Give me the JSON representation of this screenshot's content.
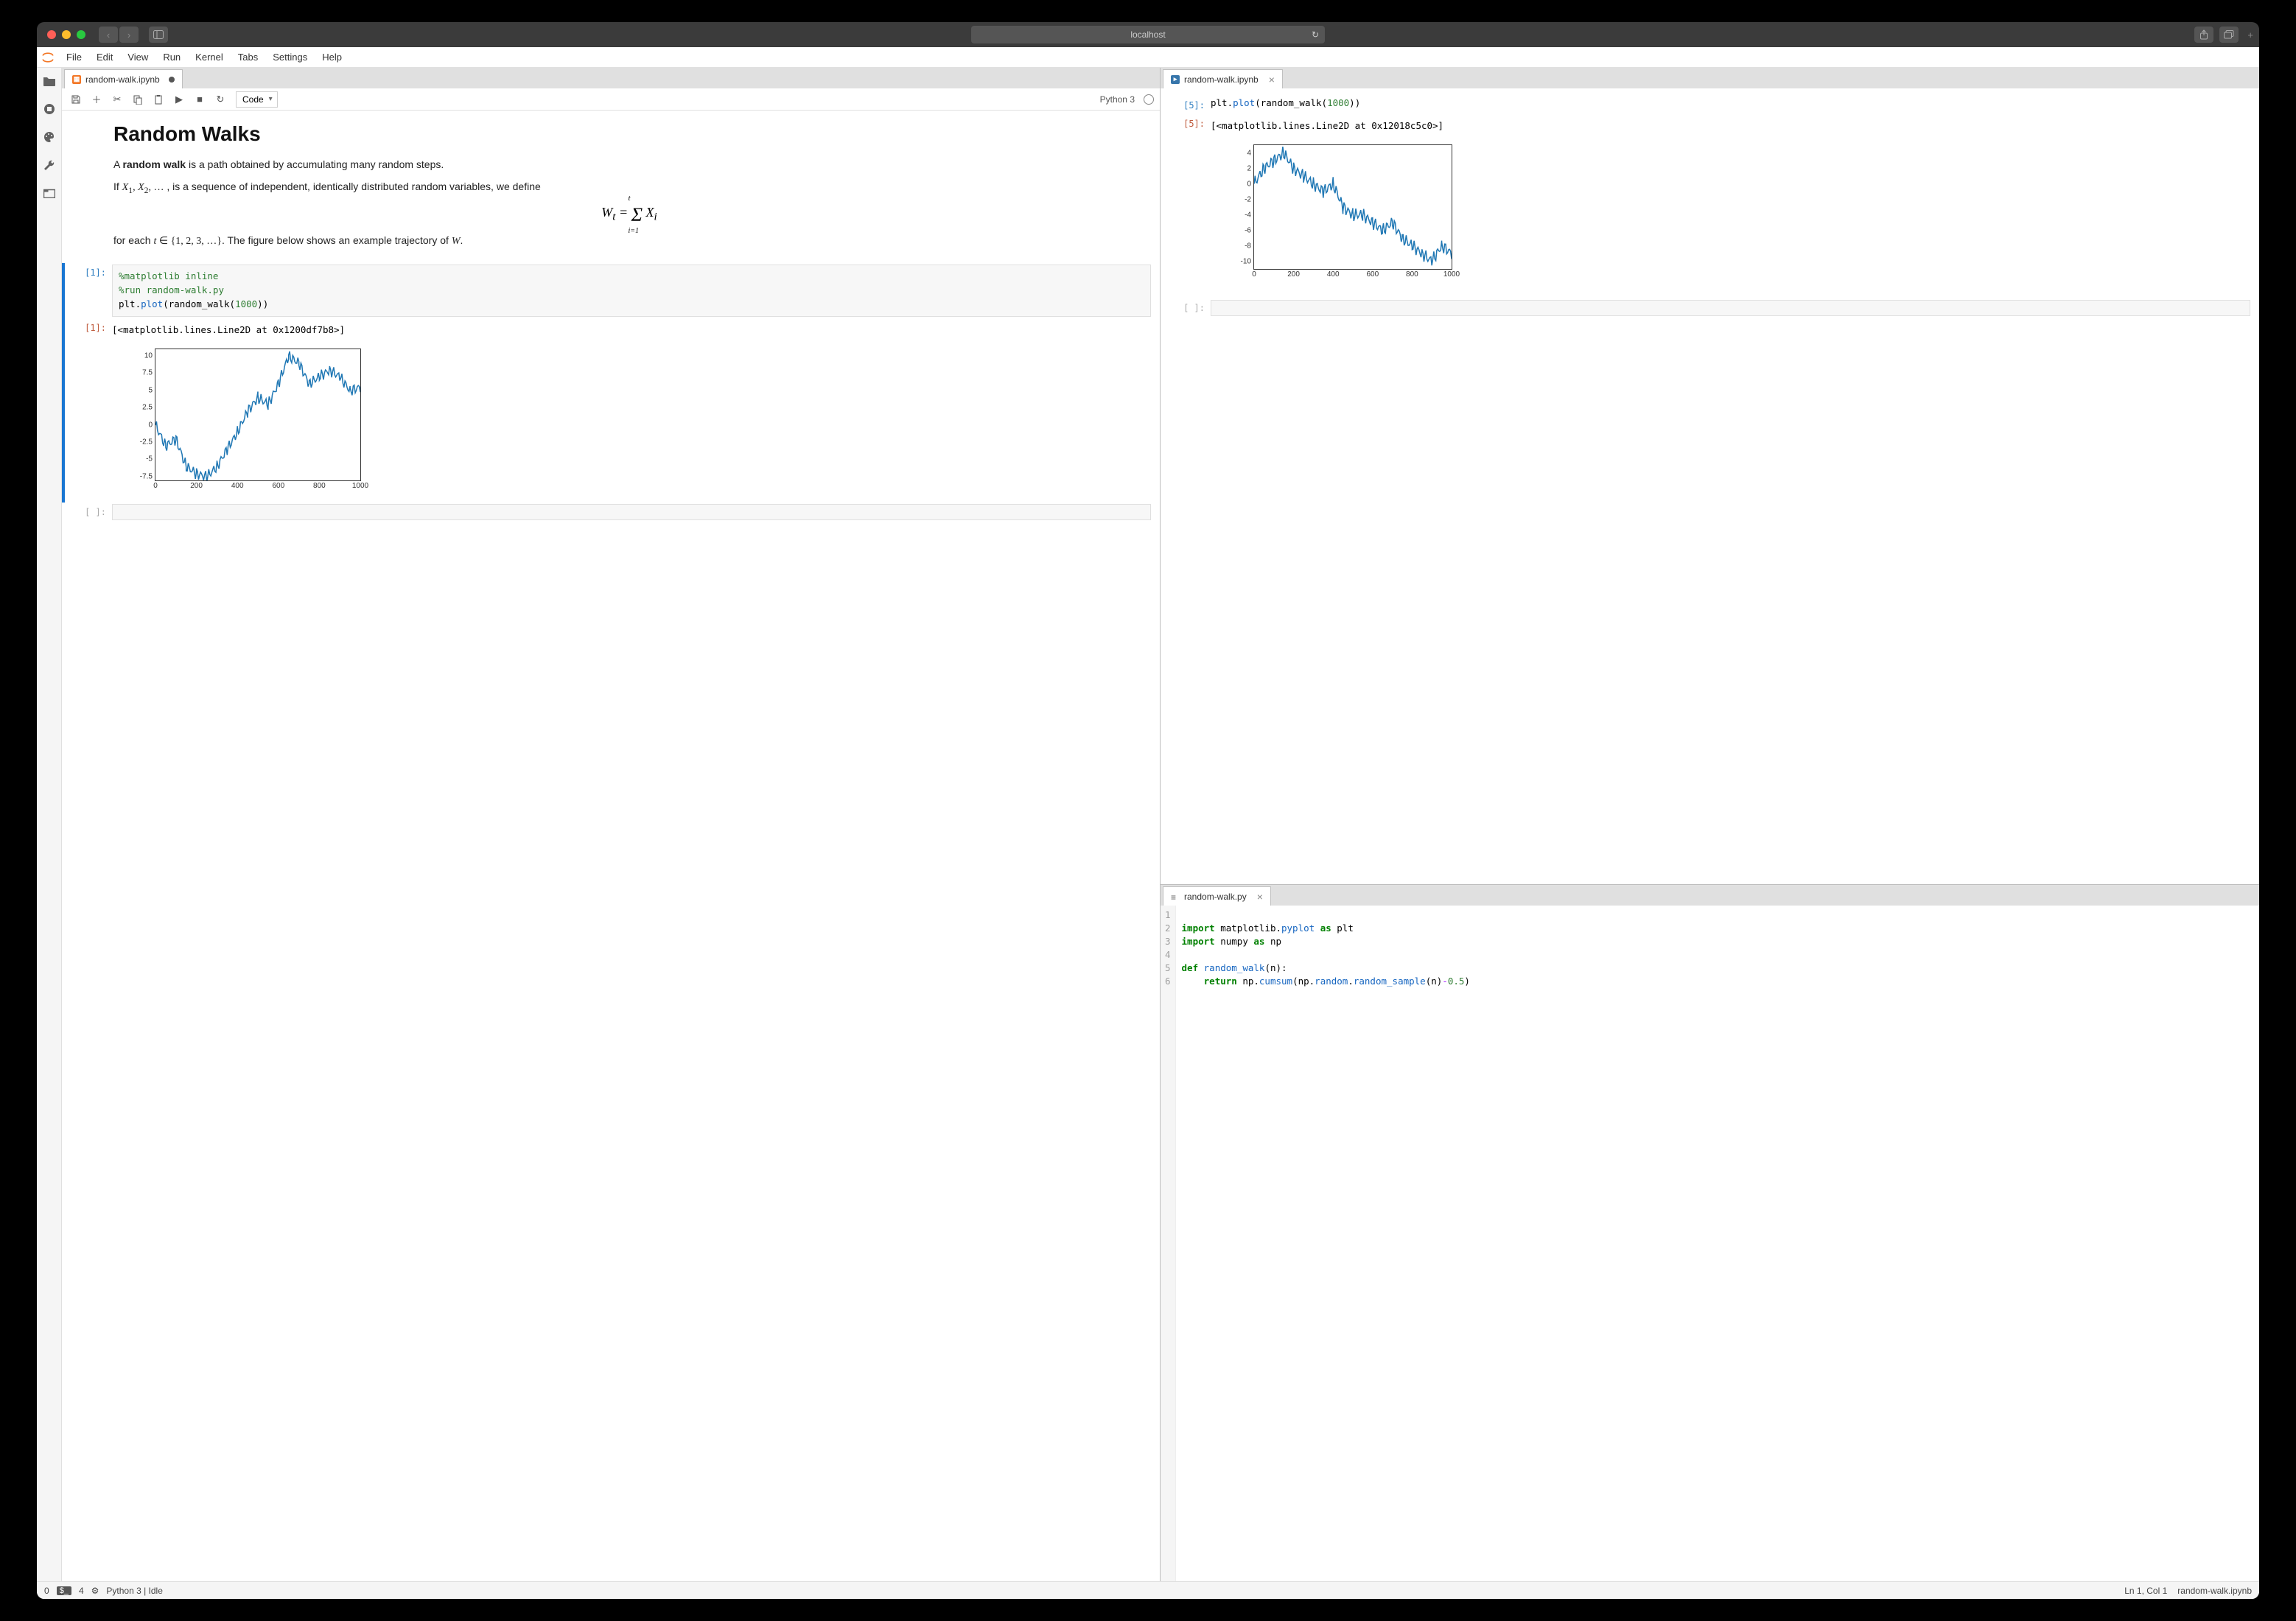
{
  "browser": {
    "address": "localhost",
    "buttons": {
      "back": "‹",
      "forward": "›",
      "sidebar": "▥",
      "share": "⇪",
      "tabs": "⧉",
      "plus": "+",
      "reload": "↻"
    }
  },
  "menubar": [
    "File",
    "Edit",
    "View",
    "Run",
    "Kernel",
    "Tabs",
    "Settings",
    "Help"
  ],
  "iconbar": [
    "folder",
    "running",
    "palette",
    "wrench",
    "tabs"
  ],
  "left_panel": {
    "tab_title": "random-walk.ipynb",
    "unsaved": true,
    "toolbar": {
      "cell_type": "Code",
      "kernel_name": "Python 3"
    },
    "markdown": {
      "title": "Random Walks",
      "p1_pre": "A ",
      "p1_bold": "random walk",
      "p1_post": " is a path obtained by accumulating many random steps.",
      "p2": "If X₁, X₂, … , is a sequence of independent, identically distributed random variables, we define",
      "eq": "Wₜ = Σ Xᵢ  (i=1…t)",
      "p3": "for each t ∈ {1, 2, 3, …}. The figure below shows an example trajectory of W."
    },
    "cell1": {
      "prompt_in": "[1]:",
      "prompt_out": "[1]:",
      "code_line1": "%matplotlib inline",
      "code_line2": "%run random-walk.py",
      "code_line3_a": "plt.",
      "code_line3_b": "plot",
      "code_line3_c": "(random_walk(",
      "code_line3_d": "1000",
      "code_line3_e": "))",
      "output": "[<matplotlib.lines.Line2D at 0x1200df7b8>]"
    },
    "empty_prompt": "[ ]:"
  },
  "right_top": {
    "tab_title": "random-walk.ipynb",
    "cell": {
      "prompt_in": "[5]:",
      "prompt_out": "[5]:",
      "code_a": "plt.",
      "code_b": "plot",
      "code_c": "(random_walk(",
      "code_d": "1000",
      "code_e": "))",
      "output": "[<matplotlib.lines.Line2D at 0x12018c5c0>]"
    },
    "empty_prompt": "[ ]:"
  },
  "right_bottom": {
    "tab_title": "random-walk.py",
    "lines": {
      "1": "",
      "2": {
        "a": "import",
        "b": " matplotlib.",
        "c": "pyplot",
        "d": " ",
        "e": "as",
        "f": " plt"
      },
      "3": {
        "a": "import",
        "b": " numpy ",
        "c": "as",
        "d": " np"
      },
      "4": "",
      "5": {
        "a": "def",
        "b": " ",
        "c": "random_walk",
        "d": "(n):"
      },
      "6": {
        "a": "    ",
        "b": "return",
        "c": " np.",
        "d": "cumsum",
        "e": "(np.",
        "f": "random",
        "g": ".",
        "h": "random_sample",
        "i": "(n)",
        "j": "-",
        "k": "0.5",
        "l": ")"
      }
    }
  },
  "statusbar": {
    "left_a": "0",
    "left_b": "4",
    "kernel": "Python 3 | Idle",
    "right_a": "Ln 1, Col 1",
    "right_b": "random-walk.ipynb"
  },
  "chart_data": [
    {
      "type": "line",
      "title": "",
      "xlabel": "",
      "ylabel": "",
      "xlim": [
        0,
        1000
      ],
      "ylim": [
        -8,
        11
      ],
      "xticks": [
        0,
        200,
        400,
        600,
        800,
        1000
      ],
      "yticks": [
        -7.5,
        -5.0,
        -2.5,
        0.0,
        2.5,
        5.0,
        7.5,
        10.0
      ],
      "x": [
        0,
        50,
        100,
        150,
        200,
        250,
        300,
        350,
        400,
        450,
        500,
        550,
        600,
        650,
        700,
        750,
        800,
        850,
        900,
        950,
        1000
      ],
      "values": [
        0,
        -3,
        -2,
        -6,
        -7,
        -7.5,
        -6,
        -3.5,
        -1,
        2,
        4,
        3,
        6,
        10,
        9,
        6,
        7,
        8,
        7,
        5,
        5.5
      ]
    },
    {
      "type": "line",
      "title": "",
      "xlabel": "",
      "ylabel": "",
      "xlim": [
        0,
        1000
      ],
      "ylim": [
        -11,
        5
      ],
      "xticks": [
        0,
        200,
        400,
        600,
        800,
        1000
      ],
      "yticks": [
        -10,
        -8,
        -6,
        -4,
        -2,
        0,
        2,
        4
      ],
      "x": [
        0,
        50,
        100,
        150,
        200,
        250,
        300,
        350,
        400,
        450,
        500,
        550,
        600,
        650,
        700,
        750,
        800,
        850,
        900,
        950,
        1000
      ],
      "values": [
        0,
        2,
        3,
        4,
        2,
        1,
        0,
        -1,
        0,
        -3,
        -4,
        -4,
        -5,
        -6,
        -5,
        -7,
        -8,
        -9,
        -10,
        -8,
        -9
      ]
    }
  ]
}
